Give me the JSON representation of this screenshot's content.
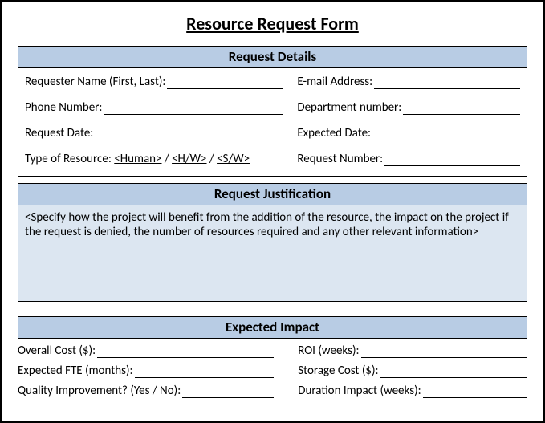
{
  "title": "Resource Request Form",
  "sections": {
    "details": {
      "heading": "Request Details",
      "fields": {
        "requester_name": "Requester Name (First, Last): ",
        "email": "E-mail Address: ",
        "phone": "Phone Number: ",
        "dept": "Department number: ",
        "request_date": "Request Date: ",
        "expected_date": "Expected Date: ",
        "type_label": "Type of Resource: ",
        "type_opt1": "<Human>",
        "type_sep": " / ",
        "type_opt2": "<H/W>",
        "type_opt3": "<S/W>",
        "request_number": "Request Number: "
      }
    },
    "justification": {
      "heading": "Request Justification",
      "placeholder": "<Specify how the project will benefit from the addition of the resource, the impact on the project if the request is denied, the number of resources required and any other relevant information>"
    },
    "impact": {
      "heading": "Expected Impact",
      "fields": {
        "overall_cost": "Overall Cost ($): ",
        "roi": "ROI (weeks): ",
        "expected_fte": "Expected FTE (months): ",
        "storage_cost": "Storage Cost ($): ",
        "quality": "Quality Improvement? (Yes / No): ",
        "duration": "Duration Impact (weeks): "
      }
    }
  }
}
